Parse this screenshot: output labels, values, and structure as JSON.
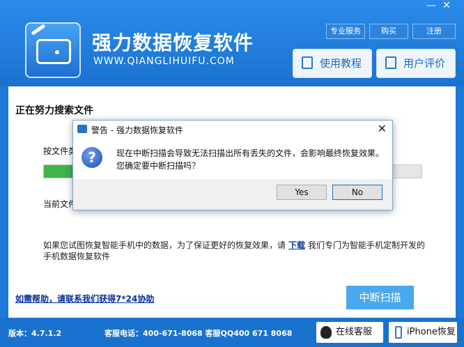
{
  "header": {
    "title": "强力数据恢复软件",
    "url": "WWW.QIANGLIHUIFU.COM",
    "links": [
      "专业服务",
      "购买",
      "注册"
    ],
    "minimize": "—",
    "close": "✕",
    "tutorial_btn": "使用教程",
    "review_btn": "用户评价"
  },
  "main": {
    "section_title": "正在努力搜索文件",
    "by_type_label": "按文件类",
    "progress": 0.1,
    "current_file_label": "当前文件",
    "info_before": "如果您试图恢复智能手机中的数据，为了保证更好的恢复效果，请",
    "info_link": "下载",
    "info_after": "我们专门为智能手机定制开发的手机数据恢复软件",
    "help_link": "如需帮助，请联系我们获得7*24协助",
    "stop_btn": "中断扫描"
  },
  "footer": {
    "version": "版本：4.7.1.2",
    "phone": "客服电话：400-671-8068 客服QQ400 671 8068",
    "online_btn": "在线客服",
    "iphone_btn": "iPhone恢复"
  },
  "dialog": {
    "title": "警告 - 强力数据恢复软件",
    "close": "✕",
    "icon_char": "?",
    "line1": "现在中断扫描会导致无法扫描出所有丢失的文件，会影响最终恢复效果。",
    "line2": "您确定要中断扫描吗？",
    "yes": "Yes",
    "no": "No"
  }
}
